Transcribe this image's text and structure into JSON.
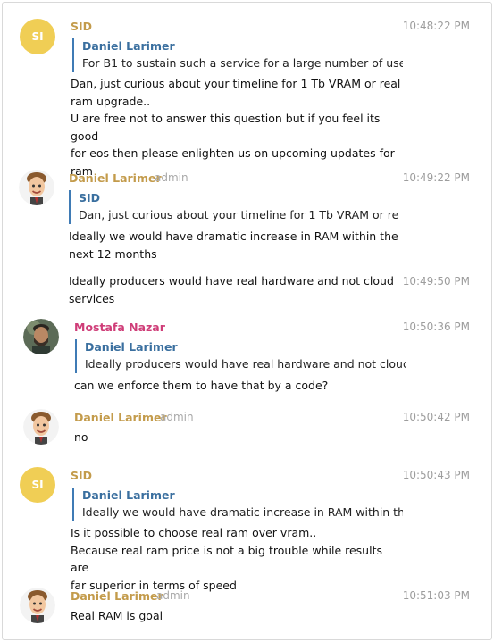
{
  "messages": [
    {
      "avatar_initials": "SI",
      "name": "SID",
      "role": "",
      "time": "10:48:22 PM",
      "quote_name": "Daniel Larimer",
      "quote_text": "For B1 to sustain such a service for a large number of use…",
      "text_lines": [
        "Dan, just curious about your timeline for 1 Tb VRAM or real",
        "ram upgrade..",
        "U are free not to answer this question but if you feel its good",
        "for eos then please enlighten us on upcoming updates for",
        "ram"
      ]
    },
    {
      "avatar_icon": "daniel-avatar",
      "name": "Daniel Larimer",
      "role": "admin",
      "time": "10:49:22 PM",
      "quote_name": "SID",
      "quote_text": "Dan, just curious about your timeline for 1 Tb VRAM or re…",
      "text_lines": [
        "Ideally we would have dramatic increase in RAM within the",
        "next 12 months"
      ]
    },
    {
      "time": "10:49:50 PM",
      "text_lines": [
        "Ideally producers would have real hardware and not cloud",
        "services"
      ]
    },
    {
      "avatar_icon": "mostafa-avatar",
      "name": "Mostafa Nazar",
      "role": "",
      "time": "10:50:36 PM",
      "quote_name": "Daniel Larimer",
      "quote_text": "Ideally producers would have real hardware and not cloud…",
      "text_lines": [
        "can we enforce them to have that by a code?"
      ]
    },
    {
      "avatar_icon": "daniel-avatar",
      "name": "Daniel Larimer",
      "role": "admin",
      "time": "10:50:42 PM",
      "text_lines": [
        "no"
      ]
    },
    {
      "avatar_initials": "SI",
      "name": "SID",
      "role": "",
      "time": "10:50:43 PM",
      "quote_name": "Daniel Larimer",
      "quote_text": "Ideally we would have dramatic increase in RAM within th…",
      "text_lines": [
        "Is it possible to choose real ram over vram..",
        "Because real ram price is not a big trouble while results are",
        "far superior in terms of speed"
      ]
    },
    {
      "avatar_icon": "daniel-avatar",
      "name": "Daniel Larimer",
      "role": "admin",
      "time": "10:51:03 PM",
      "text_lines": [
        "Real RAM is goal"
      ]
    }
  ],
  "colors": {
    "initials_avatar_bg": "#f0ce55",
    "name_gold": "#c39b4b",
    "name_pink": "#cf3d78",
    "quote_bar": "#3f7bb5",
    "quote_name": "#3a6f9f"
  }
}
